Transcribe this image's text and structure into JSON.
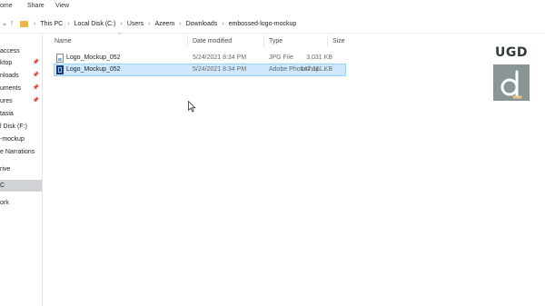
{
  "ribbon": {
    "tabs": [
      "ome",
      "Share",
      "View"
    ]
  },
  "address": {
    "breadcrumbs": [
      "This PC",
      "Local Disk (C:)",
      "Users",
      "Azeem",
      "Downloads",
      "embossed-logo-mockup"
    ]
  },
  "sidebar": {
    "items": [
      {
        "label": "access",
        "pinned": false
      },
      {
        "label": "ktop",
        "pinned": true
      },
      {
        "label": "nloads",
        "pinned": true
      },
      {
        "label": "uments",
        "pinned": true
      },
      {
        "label": "ures",
        "pinned": true
      },
      {
        "label": "tasia",
        "pinned": false
      },
      {
        "label": "l Disk (F:)",
        "pinned": false
      },
      {
        "label": "-mockup",
        "pinned": false
      },
      {
        "label": "e Narrations",
        "pinned": false
      },
      {
        "label": "rive",
        "pinned": false
      },
      {
        "label": "C",
        "pinned": false,
        "selected": true
      },
      {
        "label": "ork",
        "pinned": false
      }
    ]
  },
  "columns": {
    "name": "Name",
    "date_modified": "Date modified",
    "type": "Type",
    "size": "Size"
  },
  "files": [
    {
      "name": "Logo_Mockup_052",
      "date": "5/24/2021 8:34 PM",
      "type": "JPG File",
      "size": "3,031 KB",
      "icon": "jpg-file-icon",
      "selected": false
    },
    {
      "name": "Logo_Mockup_052",
      "date": "5/24/2021 8:34 PM",
      "type": "Adobe Photoshop ...",
      "size": "147,111 KB",
      "icon": "psd-file-icon",
      "selected": true
    }
  ],
  "watermark": {
    "text": "UGD",
    "colors": {
      "text": "#2f3a3a",
      "box": "#8a9695",
      "glyph": "#ffffff",
      "accent": "#e8c58a"
    }
  }
}
